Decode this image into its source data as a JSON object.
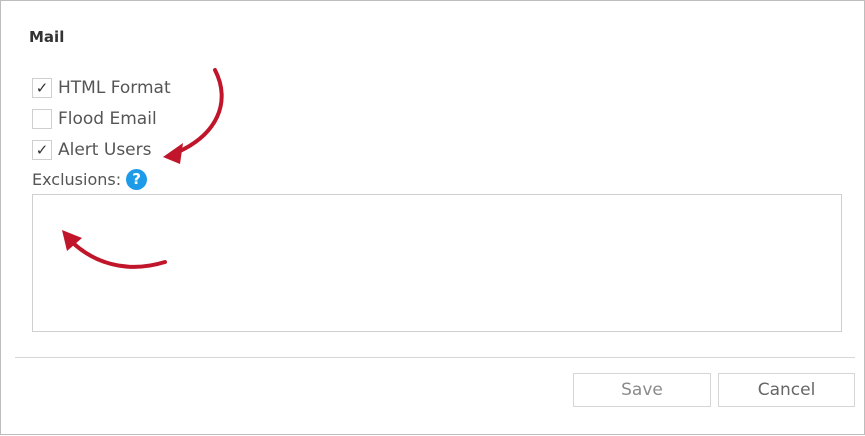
{
  "section": {
    "title": "Mail"
  },
  "options": [
    {
      "label": "HTML Format",
      "checked": true
    },
    {
      "label": "Flood Email",
      "checked": false
    },
    {
      "label": "Alert Users",
      "checked": true
    }
  ],
  "exclusions": {
    "label": "Exclusions:",
    "help_icon": "?",
    "value": ""
  },
  "buttons": {
    "save": "Save",
    "cancel": "Cancel"
  },
  "colors": {
    "help": "#1e9be8",
    "annotation_arrow": "#c0152a"
  }
}
